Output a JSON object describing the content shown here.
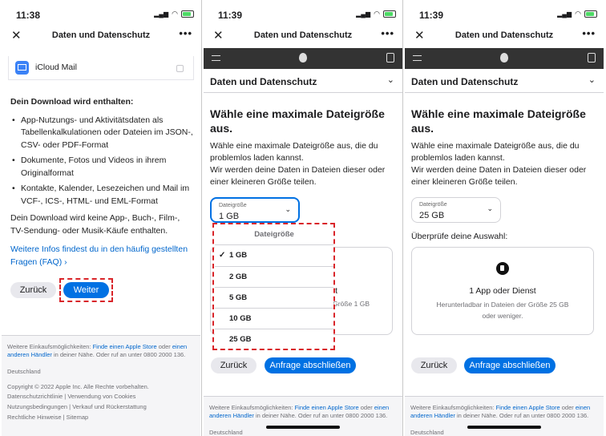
{
  "status": {
    "p1_time": "11:38",
    "p2_time": "11:39",
    "p3_time": "11:39"
  },
  "nav": {
    "title": "Daten und Datenschutz",
    "close": "✕",
    "more": "•••"
  },
  "section": {
    "title": "Daten und Datenschutz",
    "chevron": "⌄"
  },
  "p1": {
    "mail_label": "iCloud Mail",
    "download_heading": "Dein Download wird enthalten:",
    "items": [
      "App-Nutzungs- und Aktivitätsdaten als Tabellenkalkulationen oder Dateien im JSON-, CSV- oder PDF-Format",
      "Dokumente, Fotos und Videos in ihrem Originalformat",
      "Kontakte, Kalender, Lesezeichen und Mail im VCF-, ICS-, HTML- und EML-Format"
    ],
    "excluded": "Dein Download wird keine App-, Buch-, Film-, TV-Sendung- oder Musik-Käufe enthalten.",
    "more_info": "Weitere Infos findest du in den häufig gestellten Fragen (FAQ) ›",
    "back_button": "Zurück",
    "next_button": "Weiter"
  },
  "footer": {
    "line1_a": "Weitere Einkaufsmöglichkeiten: ",
    "line1_link": "Finde einen Apple Store",
    "line1_b": " oder ",
    "line1_link2": "einen anderen Händler",
    "line1_c": " in deiner Nähe. Oder ruf an unter 0800 2000 136.",
    "country": "Deutschland",
    "copyright": "Copyright © 2022 Apple Inc. Alle Rechte vorbehalten.",
    "links": [
      "Datenschutzrichtlinie",
      "Verwendung von Cookies",
      "Nutzungsbedingungen",
      "Verkauf und Rückerstattung",
      "Rechtliche Hinweise",
      "Sitemap"
    ]
  },
  "size": {
    "heading": "Wähle eine maximale Dateigröße aus.",
    "para1": "Wähle eine maximale Dateigröße aus, die du problemlos laden kannst.",
    "para2": "Wir werden deine Daten in Dateien dieser oder einer kleineren Größe teilen.",
    "select_label": "Dateigröße",
    "p2_value": "1 GB",
    "p3_value": "25 GB",
    "dropdown_header": "Dateigröße",
    "options": [
      "1 GB",
      "2 GB",
      "5 GB",
      "10 GB",
      "25 GB"
    ],
    "selected_mark": "✓",
    "back_button": "Zurück",
    "submit_button": "Anfrage abschließen",
    "partial_t": "t",
    "partial_size": "Größe 1 GB"
  },
  "review": {
    "heading": "Überprüfe deine Auswahl:",
    "title": "1 App oder Dienst",
    "desc": "Herunterladbar in Dateien der Größe 25 GB oder weniger."
  }
}
